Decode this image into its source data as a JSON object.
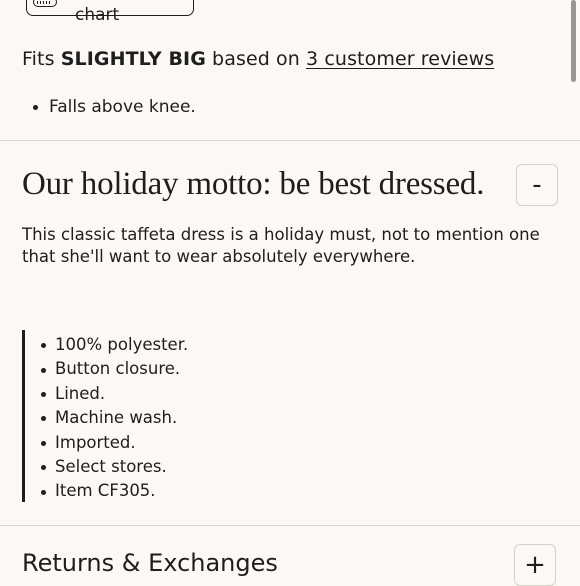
{
  "size_chart": {
    "label": "View size chart",
    "icon": "ruler-icon"
  },
  "fit": {
    "prefix": "Fits",
    "verdict": "SLIGHTLY BIG",
    "middle": "based on",
    "reviews_link": "3 customer reviews"
  },
  "fit_notes": [
    "Falls above knee."
  ],
  "motto_section": {
    "title": "Our holiday motto: be best dressed.",
    "toggle": "-",
    "description": "This classic taffeta dress is a holiday must, not to mention one that she'll want to wear absolutely everywhere.",
    "details": [
      "100% polyester.",
      "Button closure.",
      "Lined.",
      "Machine wash.",
      "Imported.",
      "Select stores.",
      "Item CF305."
    ]
  },
  "returns_section": {
    "title": "Returns & Exchanges",
    "toggle": "+"
  }
}
